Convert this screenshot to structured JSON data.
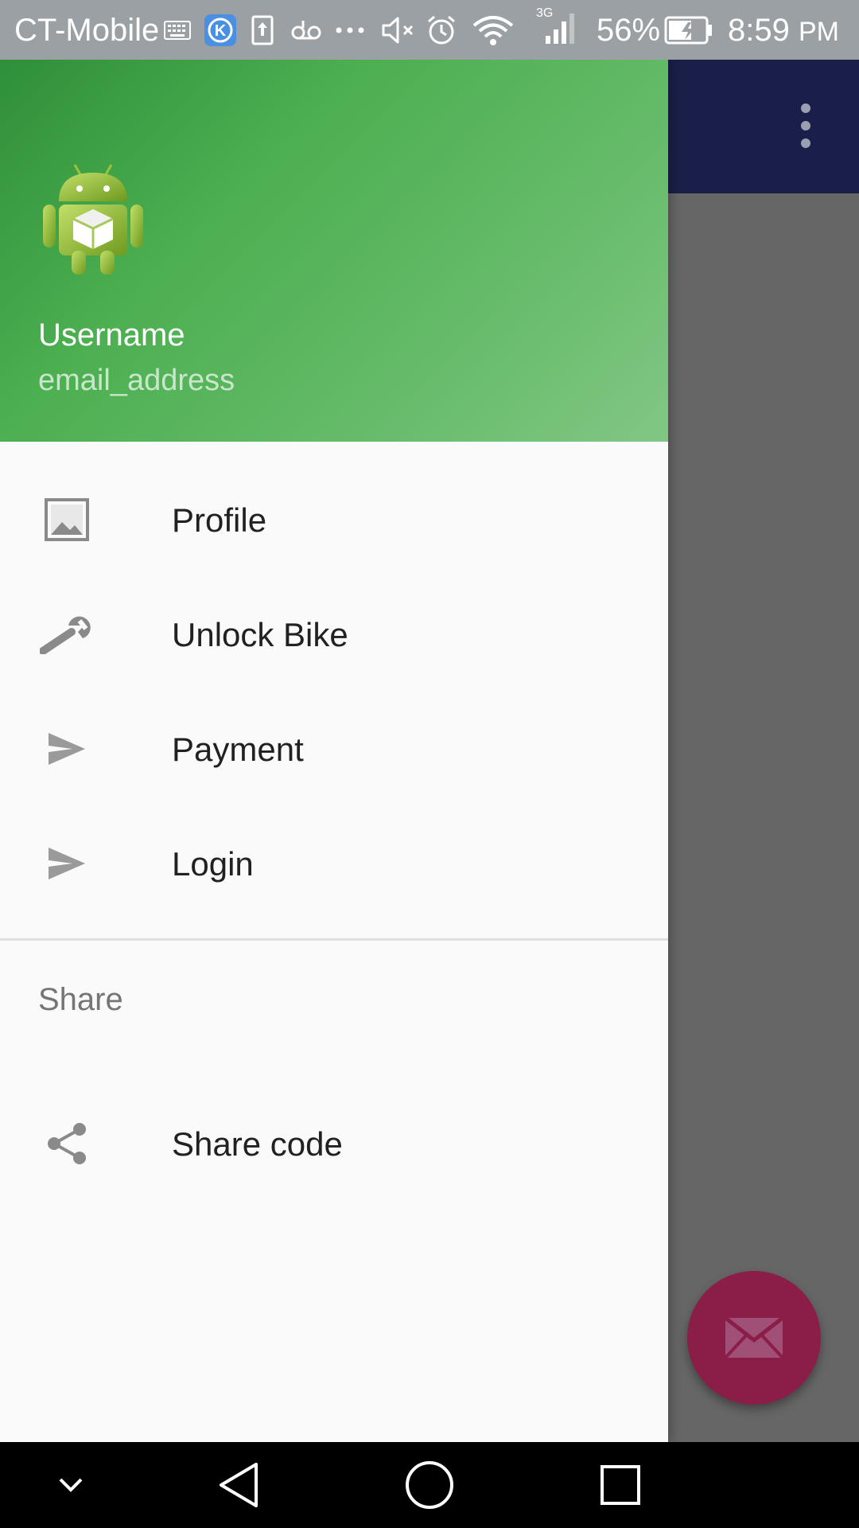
{
  "status_bar": {
    "carrier": "CT-Mobile",
    "network_type": "3G",
    "battery_percent": "56%",
    "time": "8:59",
    "time_suffix": "PM",
    "icons": [
      "keyboard-icon",
      "k-app-icon",
      "upload-icon",
      "voicemail-icon",
      "more-notifications-icon",
      "mute-icon",
      "alarm-icon",
      "wifi-icon",
      "signal-icon",
      "battery-icon"
    ]
  },
  "drawer": {
    "header": {
      "username": "Username",
      "email": "email_address",
      "avatar_icon": "android-robot-icon",
      "gradient_colors": [
        "#2f8f3a",
        "#81c784"
      ]
    },
    "items": [
      {
        "label": "Profile",
        "icon": "image-icon"
      },
      {
        "label": "Unlock Bike",
        "icon": "wrench-icon"
      },
      {
        "label": "Payment",
        "icon": "send-icon"
      },
      {
        "label": "Login",
        "icon": "send-icon"
      }
    ],
    "section": {
      "title": "Share",
      "items": [
        {
          "label": "Share code",
          "icon": "share-icon"
        }
      ]
    }
  },
  "app": {
    "toolbar_color": "#1a1f4a",
    "overflow_icon": "more-vert-icon",
    "fab_icon": "mail-icon",
    "fab_color": "#8a1e48"
  },
  "nav_bar": {
    "buttons": [
      "hide-keyboard-icon",
      "back-icon",
      "home-icon",
      "recents-icon"
    ]
  }
}
